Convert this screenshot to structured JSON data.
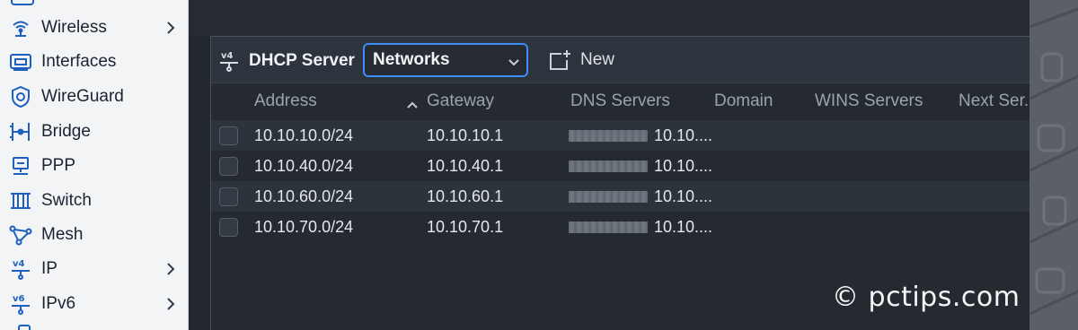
{
  "sidebar": {
    "items": [
      {
        "label": "Wireless",
        "icon": "wireless-icon",
        "has_chevron": true
      },
      {
        "label": "Interfaces",
        "icon": "interfaces-icon",
        "has_chevron": false
      },
      {
        "label": "WireGuard",
        "icon": "wireguard-icon",
        "has_chevron": false
      },
      {
        "label": "Bridge",
        "icon": "bridge-icon",
        "has_chevron": false
      },
      {
        "label": "PPP",
        "icon": "ppp-icon",
        "has_chevron": false
      },
      {
        "label": "Switch",
        "icon": "switch-icon",
        "has_chevron": false
      },
      {
        "label": "Mesh",
        "icon": "mesh-icon",
        "has_chevron": false
      },
      {
        "label": "IP",
        "icon": "ipv4-icon",
        "has_chevron": true
      },
      {
        "label": "IPv6",
        "icon": "ipv6-icon",
        "has_chevron": true
      }
    ]
  },
  "panel": {
    "title": "DHCP Server",
    "title_icon": "ipv4-icon",
    "select_value": "Networks",
    "new_label": "New"
  },
  "table": {
    "columns": [
      "Address",
      "Gateway",
      "DNS Servers",
      "Domain",
      "WINS Servers",
      "Next Ser..."
    ],
    "sorted_column": "Gateway",
    "sort_direction": "ascending",
    "rows": [
      {
        "address": "10.10.10.0/24",
        "gateway": "10.10.10.1",
        "dns": "10.10...."
      },
      {
        "address": "10.10.40.0/24",
        "gateway": "10.10.40.1",
        "dns": "10.10...."
      },
      {
        "address": "10.10.60.0/24",
        "gateway": "10.10.60.1",
        "dns": "10.10...."
      },
      {
        "address": "10.10.70.0/24",
        "gateway": "10.10.70.1",
        "dns": "10.10...."
      }
    ]
  },
  "watermark": "© pctips.com",
  "colors": {
    "accent": "#3d8ef5",
    "sidebar_icon": "#1f5fbf",
    "panel_bg": "#252a31",
    "sidebar_bg": "#f3f4f6"
  }
}
